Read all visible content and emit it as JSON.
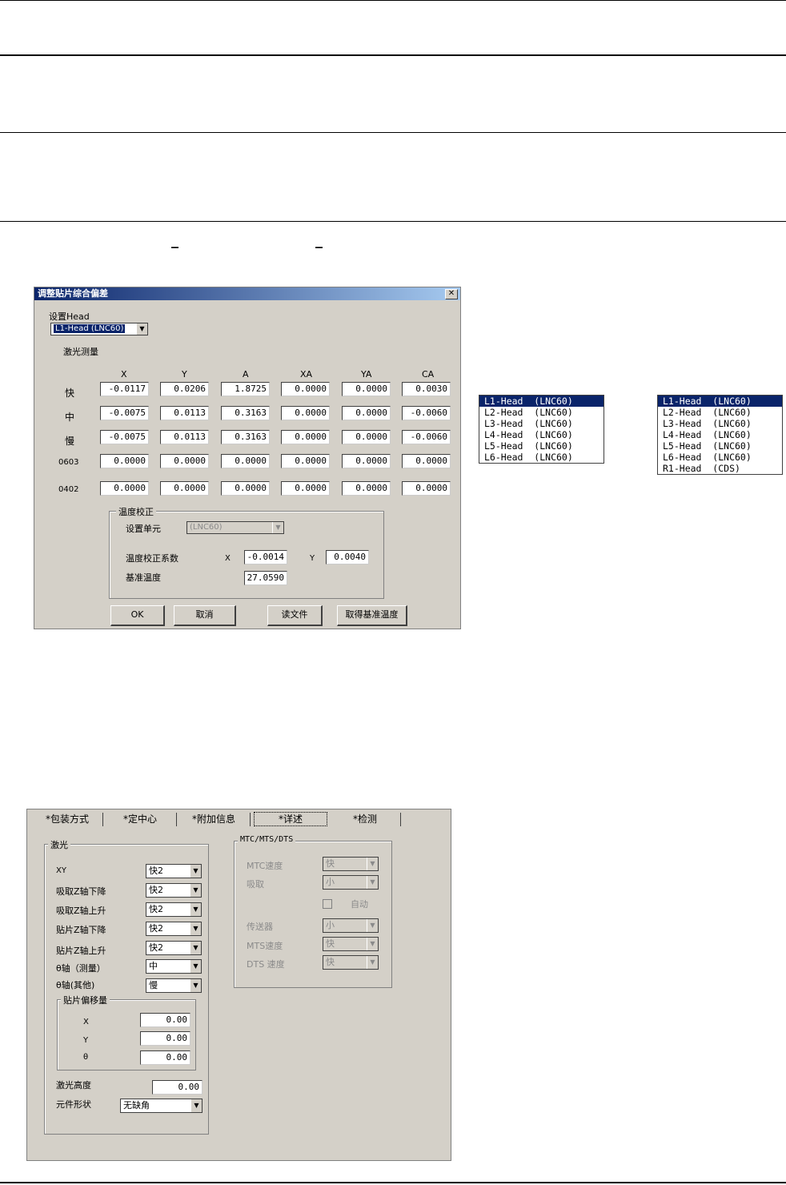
{
  "doc": {
    "underline_mark": "_"
  },
  "dialog": {
    "title": "调整贴片综合偏差",
    "close": "✕",
    "set_head_label": "设置Head",
    "head_value": "L1-Head  (LNC60)",
    "laser_label": "激光测量",
    "columns": [
      "X",
      "Y",
      "A",
      "XA",
      "YA",
      "CA"
    ],
    "rows": [
      {
        "label": "快",
        "values": [
          "-0.0117",
          "0.0206",
          "1.8725",
          "0.0000",
          "0.0000",
          "0.0030"
        ]
      },
      {
        "label": "中",
        "values": [
          "-0.0075",
          "0.0113",
          "0.3163",
          "0.0000",
          "0.0000",
          "-0.0060"
        ]
      },
      {
        "label": "慢",
        "values": [
          "-0.0075",
          "0.0113",
          "0.3163",
          "0.0000",
          "0.0000",
          "-0.0060"
        ]
      },
      {
        "label": "0603",
        "values": [
          "0.0000",
          "0.0000",
          "0.0000",
          "0.0000",
          "0.0000",
          "0.0000"
        ]
      },
      {
        "label": "0402",
        "values": [
          "0.0000",
          "0.0000",
          "0.0000",
          "0.0000",
          "0.0000",
          "0.0000"
        ]
      }
    ],
    "temp": {
      "group_title": "温度校正",
      "unit_label": "设置单元",
      "unit_value": "(LNC60)",
      "coef_label": "温度校正系数",
      "x_label": "X",
      "x_value": "-0.0014",
      "y_label": "Y",
      "y_value": "0.0040",
      "base_label": "基准温度",
      "base_value": "27.0590"
    },
    "buttons": {
      "ok": "OK",
      "cancel": "取消",
      "read_file": "读文件",
      "get_base_temp": "取得基准温度"
    }
  },
  "list_a": [
    "L1-Head  (LNC60)",
    "L2-Head  (LNC60)",
    "L3-Head  (LNC60)",
    "L4-Head  (LNC60)",
    "L5-Head  (LNC60)",
    "L6-Head  (LNC60)"
  ],
  "list_b": [
    "L1-Head  (LNC60)",
    "L2-Head  (LNC60)",
    "L3-Head  (LNC60)",
    "L4-Head  (LNC60)",
    "L5-Head  (LNC60)",
    "L6-Head  (LNC60)",
    "R1-Head  (CDS)"
  ],
  "panel": {
    "tabs": [
      "*包装方式",
      "*定中心",
      "*附加信息",
      "*详述",
      "*检测"
    ],
    "active_tab": "*详述",
    "laser": {
      "group_title": "激光",
      "items": [
        {
          "label": "XY",
          "value": "快2"
        },
        {
          "label": "吸取Z轴下降",
          "value": "快2"
        },
        {
          "label": "吸取Z轴上升",
          "value": "快2"
        },
        {
          "label": "贴片Z轴下降",
          "value": "快2"
        },
        {
          "label": "贴片Z轴上升",
          "value": "快2"
        },
        {
          "label": "θ轴（测量）",
          "value": "中"
        },
        {
          "label": "θ轴(其他)",
          "value": "慢"
        }
      ],
      "offset_title": "贴片偏移量",
      "offset": [
        {
          "label": "X",
          "value": "0.00"
        },
        {
          "label": "Y",
          "value": "0.00"
        },
        {
          "label": "θ",
          "value": "0.00"
        }
      ],
      "height_label": "激光高度",
      "height_value": "0.00",
      "shape_label": "元件形状",
      "shape_value": "无缺角"
    },
    "mtc": {
      "group_title": "MTC/MTS/DTS",
      "mtc_speed_label": "MTC速度",
      "mtc_speed_value": "快",
      "pick_label": "吸取",
      "pick_value": "小",
      "auto_label": "自动",
      "conveyor_label": "传送器",
      "conveyor_value": "小",
      "mts_speed_label": "MTS速度",
      "mts_speed_value": "快",
      "dts_speed_label": "DTS 速度",
      "dts_speed_value": "快"
    }
  }
}
